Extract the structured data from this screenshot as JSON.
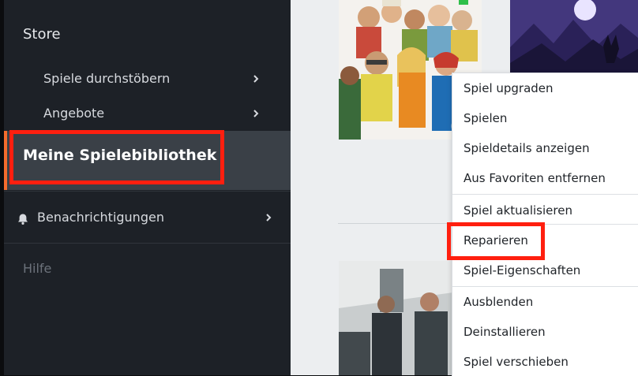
{
  "sidebar": {
    "store_label": "Store",
    "items": [
      {
        "label": "Spiele durchstöbern"
      },
      {
        "label": "Angebote"
      }
    ],
    "library_label": "Meine Spielebibliothek",
    "notifications_label": "Benachrichtigungen",
    "help_label": "Hilfe"
  },
  "context_menu": {
    "items": [
      {
        "label": "Spiel upgraden"
      },
      {
        "label": "Spielen"
      },
      {
        "label": "Spieldetails anzeigen"
      },
      {
        "label": "Aus Favoriten entfernen"
      },
      {
        "label": "Spiel aktualisieren"
      },
      {
        "label": "Reparieren"
      },
      {
        "label": "Spiel-Eigenschaften"
      },
      {
        "label": "Ausblenden"
      },
      {
        "label": "Deinstallieren"
      },
      {
        "label": "Spiel verschieben"
      }
    ]
  },
  "colors": {
    "sidebar_bg": "#1d2127",
    "selected_row_bg": "#3a4047",
    "accent": "#f56c2d",
    "highlight_box": "#ff1f0f",
    "content_bg": "#eceef0"
  },
  "icons": {
    "chevron": "chevron-right-icon",
    "bell": "bell-icon"
  }
}
